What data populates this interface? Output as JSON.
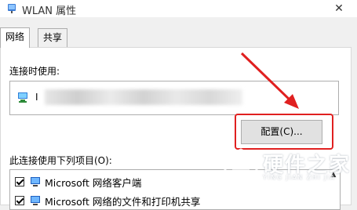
{
  "window": {
    "title": "WLAN 属性",
    "close_glyph": "✕"
  },
  "tabs": [
    {
      "label": "网络"
    },
    {
      "label": "共享"
    }
  ],
  "connect_using": {
    "label": "连接时使用:",
    "adapter_name_visible": "I"
  },
  "config_button": {
    "label": "配置(C)..."
  },
  "items_section": {
    "label": "此连接使用下列项目(O):",
    "items": [
      {
        "label": "Microsoft 网络客户端",
        "checked": true,
        "icon": "network-client-icon"
      },
      {
        "label": "Microsoft 网络的文件和打印机共享",
        "checked": true,
        "icon": "file-printer-sharing-icon"
      }
    ]
  },
  "watermark": {
    "title": "硬件之家",
    "subtitle": "YING JIAN ZHI JIA"
  },
  "colors": {
    "highlight": "#e02020",
    "arrow": "#e02020"
  }
}
